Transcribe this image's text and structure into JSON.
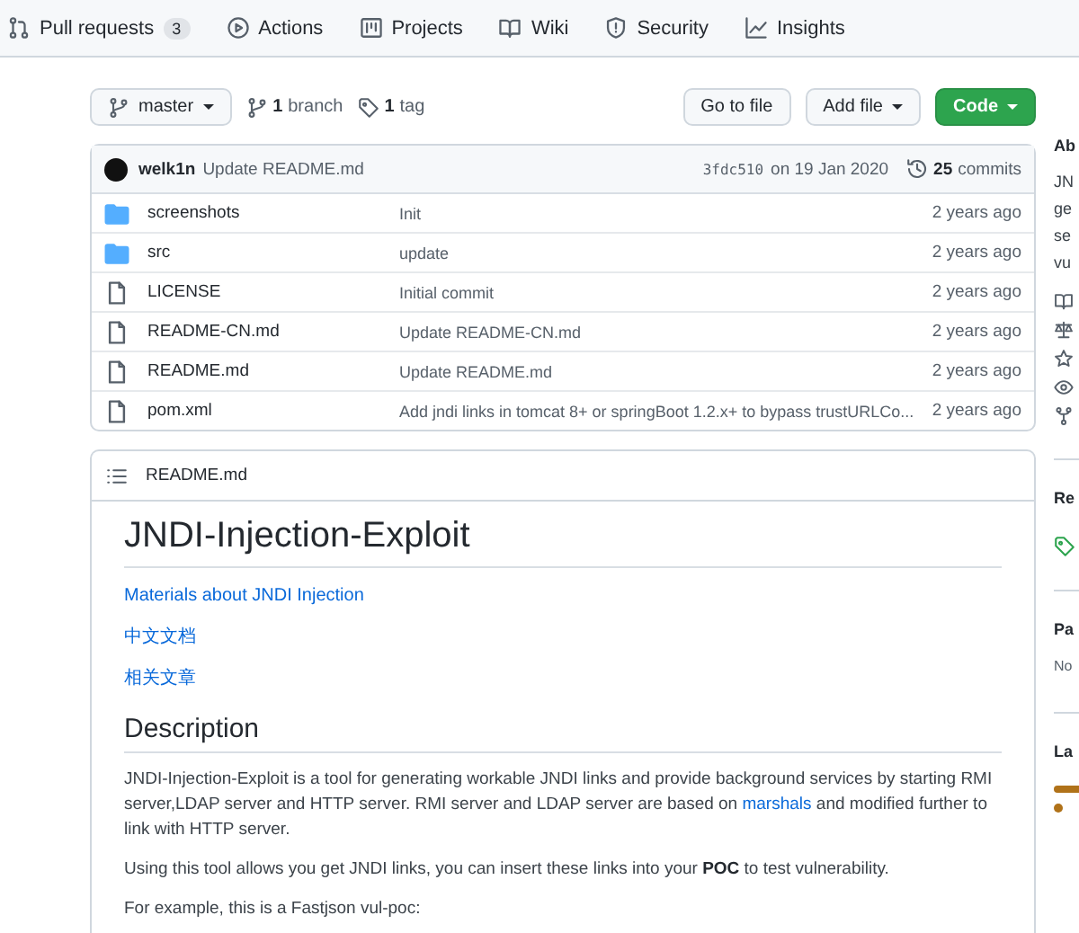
{
  "nav_tabs": [
    {
      "label": "Pull requests",
      "count": "3"
    },
    {
      "label": "Actions"
    },
    {
      "label": "Projects"
    },
    {
      "label": "Wiki"
    },
    {
      "label": "Security"
    },
    {
      "label": "Insights"
    }
  ],
  "toolbar": {
    "branch": "master",
    "branches": {
      "count": "1",
      "label": "branch"
    },
    "tags": {
      "count": "1",
      "label": "tag"
    },
    "buttons": [
      {
        "label": "Go to file",
        "kind": "plain"
      },
      {
        "label": "Add file",
        "kind": "menu"
      },
      {
        "label": "Code",
        "kind": "primary"
      }
    ]
  },
  "latest_commit": {
    "author": "welk1n",
    "message": "Update README.md",
    "sha": "3fdc510",
    "date": "on 19 Jan 2020",
    "commits_count": "25",
    "commits_label": "commits"
  },
  "files": [
    {
      "name": "screenshots",
      "kind": "folder",
      "message": "Init",
      "age": "2 years ago"
    },
    {
      "name": "src",
      "kind": "folder",
      "message": "update",
      "age": "2 years ago"
    },
    {
      "name": "LICENSE",
      "kind": "file",
      "message": "Initial commit",
      "age": "2 years ago"
    },
    {
      "name": "README-CN.md",
      "kind": "file",
      "message": "Update README-CN.md",
      "age": "2 years ago"
    },
    {
      "name": "README.md",
      "kind": "file",
      "message": "Update README.md",
      "age": "2 years ago"
    },
    {
      "name": "pom.xml",
      "kind": "file",
      "message": "Add jndi links in tomcat 8+ or springBoot 1.2.x+ to bypass trustURLCo...",
      "age": "2 years ago"
    }
  ],
  "readme": {
    "filename": "README.md",
    "title": "JNDI-Injection-Exploit",
    "links": [
      "Materials about JNDI Injection",
      "中文文档",
      "相关文章"
    ],
    "heading": "Description",
    "paragraphs": [
      [
        {
          "text": "JNDI-Injection-Exploit is a tool for generating workable JNDI links and provide background services by starting RMI server,LDAP server and HTTP server. RMI server and LDAP server are based on ",
          "link": false
        },
        {
          "text": "marshals",
          "link": true
        },
        {
          "text": " and modified further to link with HTTP server.",
          "link": false
        }
      ],
      [
        {
          "text": "Using this tool allows you get JNDI links, you can insert these links into your **POC** to test vulnerability.",
          "link": false
        }
      ],
      [
        {
          "text": "For example, this is a Fastjson vul-poc:",
          "link": false
        }
      ]
    ]
  },
  "sidebar": {
    "about_heading": "Ab",
    "about_lines": [
      "JN",
      "ge",
      "se",
      "vu"
    ],
    "releases_heading": "Re",
    "packages_heading": "Pa",
    "packages_text": "No",
    "languages_heading": "La"
  }
}
